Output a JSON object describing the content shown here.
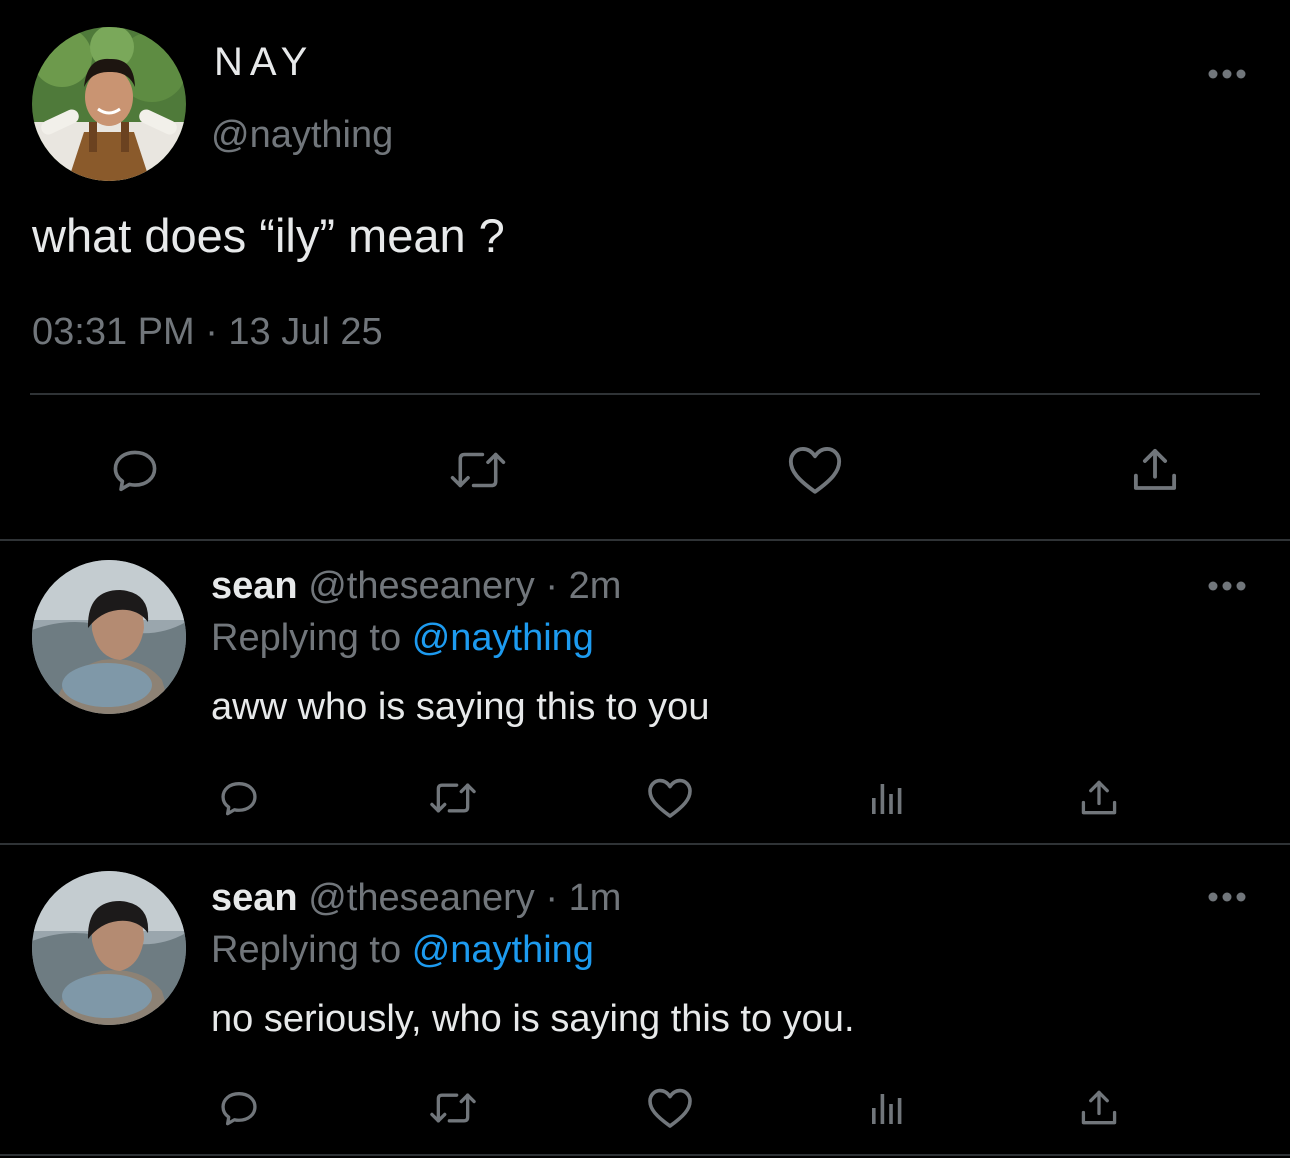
{
  "colors": {
    "background": "#000000",
    "primary_text": "#e7e9ea",
    "secondary_text": "#71767b",
    "link": "#1d9bf0",
    "divider": "#2f3336",
    "icon": "#71767b"
  },
  "main_tweet": {
    "display_name": "NAY",
    "handle": "@naything",
    "text": "what does “ily” mean ?",
    "timestamp": "03:31 PM · 13 Jul 25",
    "more_icon": "more-horizontal-icon",
    "actions": [
      {
        "name": "reply",
        "icon": "reply-icon"
      },
      {
        "name": "retweet",
        "icon": "retweet-icon"
      },
      {
        "name": "like",
        "icon": "heart-icon"
      },
      {
        "name": "share",
        "icon": "share-icon"
      }
    ]
  },
  "replies": [
    {
      "display_name": "sean",
      "handle": "@theseanery",
      "separator": "·",
      "time": "2m",
      "replying_prefix": "Replying to",
      "replying_to": "@naything",
      "text": "aww who is saying this to you"
    },
    {
      "display_name": "sean",
      "handle": "@theseanery",
      "separator": "·",
      "time": "1m",
      "replying_prefix": "Replying to",
      "replying_to": "@naything",
      "text": "no seriously, who is saying this to you."
    }
  ]
}
